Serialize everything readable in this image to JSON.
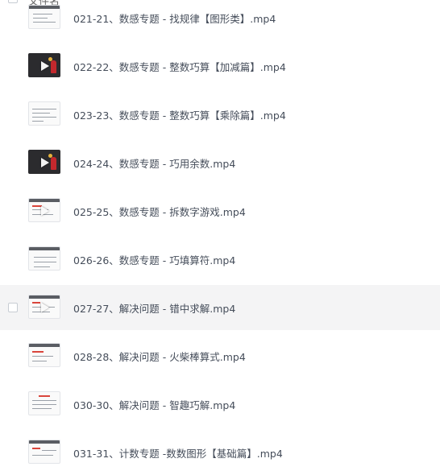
{
  "header": {
    "column_label": "文件名"
  },
  "files": [
    {
      "name": "021-21、数感专题 - 找规律【图形类】.mp4",
      "thumb": "slide-thumbnail"
    },
    {
      "name": "022-22、数感专题 - 整数巧算【加减篇】.mp4",
      "thumb": "dark-video-thumbnail"
    },
    {
      "name": "023-23、数感专题 - 整数巧算【乘除篇】.mp4",
      "thumb": "slide-thumbnail"
    },
    {
      "name": "024-24、数感专题 - 巧用余数.mp4",
      "thumb": "dark-video-thumbnail"
    },
    {
      "name": "025-25、数感专题 - 拆数字游戏.mp4",
      "thumb": "slide-thumbnail"
    },
    {
      "name": "026-26、数感专题 - 巧填算符.mp4",
      "thumb": "slide-thumbnail"
    },
    {
      "name": "027-27、解决问题 - 错中求解.mp4",
      "thumb": "slide-thumbnail"
    },
    {
      "name": "028-28、解决问题 - 火柴棒算式.mp4",
      "thumb": "slide-thumbnail"
    },
    {
      "name": "030-30、解决问题 - 智趣巧解.mp4",
      "thumb": "slide-thumbnail"
    },
    {
      "name": "031-31、计数专题 -数数图形【基础篇】.mp4",
      "thumb": "slide-thumbnail"
    }
  ],
  "hovered_index": 6,
  "colors": {
    "hover_bg": "#f4f4f5",
    "text": "#454d5a",
    "accent_red": "#d9453c"
  }
}
